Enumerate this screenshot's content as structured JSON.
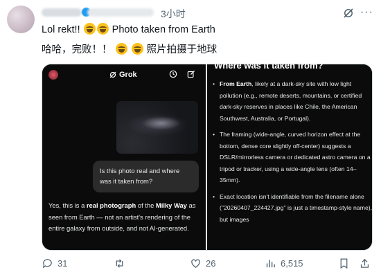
{
  "post": {
    "time": "3小时",
    "text_line1_a": "Lol rekt!!",
    "text_line1_b": "Photo taken from Earth",
    "text_line2_a": "哈哈，完败！！",
    "text_line2_b": "照片拍摄于地球"
  },
  "grok_screenshot": {
    "app_name": "Grok",
    "user_question": "Is this photo real and where was it taken from?",
    "answer_p1": "Yes, this is a ",
    "answer_b1": "real photograph",
    "answer_p2": " of the ",
    "answer_b2": "Milky Way",
    "answer_p3": " as seen from Earth — not an artist's rendering of the entire galaxy from outside, and not AI-generated.",
    "right_title": "Where was it taken from?",
    "bullet1_b": "From Earth",
    "bullet1": ", likely at a dark-sky site with low light pollution (e.g., remote deserts, mountains, or certified dark-sky reserves in places like Chile, the American Southwest, Australia, or Portugal).",
    "bullet2": "The framing (wide-angle, curved horizon effect at the bottom, dense core slightly off-center) suggests a DSLR/mirrorless camera or dedicated astro camera on a tripod or tracker, using a wide-angle lens (often 14–35mm).",
    "bullet3": "Exact location isn't identifiable from the filename alone (\"20260407_224427.jpg\" is just a timestamp-style name), but images"
  },
  "actions": {
    "replies": "31",
    "reposts": "",
    "likes": "26",
    "views": "6,515"
  },
  "icons": [
    "grok-icon",
    "more-icon",
    "history-icon",
    "edit-icon",
    "reply-icon",
    "repost-icon",
    "like-icon",
    "views-icon",
    "bookmark-icon",
    "share-icon"
  ],
  "colors": {
    "accent": "#1d9bf0",
    "muted": "#536471",
    "text": "#0f1419"
  }
}
